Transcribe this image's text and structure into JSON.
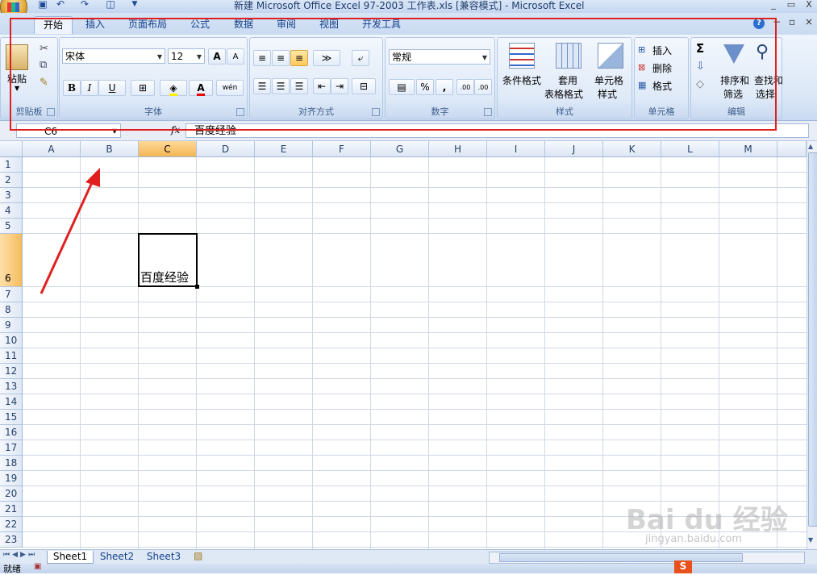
{
  "window": {
    "title": "新建 Microsoft Office Excel 97-2003 工作表.xls  [兼容模式] - Microsoft Excel",
    "help": "?",
    "minimize": "_",
    "restore": "▭",
    "close": "X"
  },
  "tabs": [
    {
      "label": "开始"
    },
    {
      "label": "插入"
    },
    {
      "label": "页面布局"
    },
    {
      "label": "公式"
    },
    {
      "label": "数据"
    },
    {
      "label": "审阅"
    },
    {
      "label": "视图"
    },
    {
      "label": "开发工具"
    }
  ],
  "clipboard": {
    "paste": "粘贴",
    "group": "剪贴板"
  },
  "font": {
    "name": "宋体",
    "size": "12",
    "grow": "A",
    "shrink": "A",
    "bold": "B",
    "italic": "I",
    "underline": "U",
    "color_letter": "A",
    "phonetic": "wén",
    "group": "字体"
  },
  "alignment": {
    "group": "对齐方式"
  },
  "number": {
    "format": "常规",
    "percent": "%",
    "comma": ",",
    "inc": ".00",
    "dec": ".00",
    "group": "数字"
  },
  "styles": {
    "conditional": "条件格式",
    "table_l1": "套用",
    "table_l2": "表格格式",
    "cell_l1": "单元格",
    "cell_l2": "样式",
    "group": "样式"
  },
  "cells": {
    "insert": "插入",
    "delete": "删除",
    "format": "格式",
    "group": "单元格"
  },
  "editing": {
    "sum": "Σ",
    "sort_l1": "排序和",
    "sort_l2": "筛选",
    "find_l1": "查找和",
    "find_l2": "选择",
    "group": "编辑"
  },
  "formula_bar": {
    "name_box": "C6",
    "fx": "fx",
    "value": "百度经验"
  },
  "columns": [
    "A",
    "B",
    "C",
    "D",
    "E",
    "F",
    "G",
    "H",
    "I",
    "J",
    "K",
    "L",
    "M"
  ],
  "rows": [
    "1",
    "2",
    "3",
    "4",
    "5",
    "6",
    "7",
    "8",
    "9",
    "10",
    "11",
    "12",
    "13",
    "14",
    "15",
    "16",
    "17",
    "18",
    "19",
    "20",
    "21",
    "22",
    "23"
  ],
  "cell_c6": "百度经验",
  "sheets": [
    "Sheet1",
    "Sheet2",
    "Sheet3"
  ],
  "status": {
    "ready": "就绪"
  },
  "watermark": {
    "brand": "Bai du 经验",
    "url": "jingyan.baidu.com"
  },
  "colors": {
    "annotation_red": "#e02020",
    "selected_header": "#f5bc5e",
    "ribbon_blue": "#dce8f7"
  }
}
